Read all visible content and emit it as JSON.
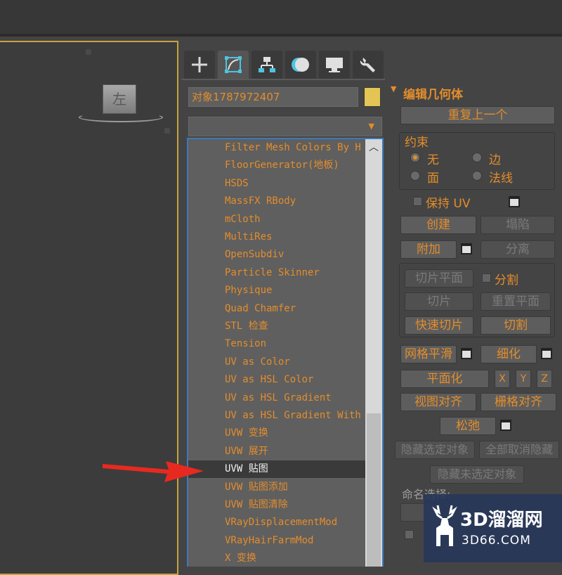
{
  "viewport": {
    "viewcube_label": "左"
  },
  "command_panel": {
    "tabs": [
      {
        "icon": "plus-icon"
      },
      {
        "icon": "modify-icon"
      },
      {
        "icon": "hierarchy-icon"
      },
      {
        "icon": "motion-icon"
      },
      {
        "icon": "display-icon"
      },
      {
        "icon": "wrench-icon"
      }
    ],
    "object_name": "对象1787972407",
    "object_color": "#e4c454",
    "modifier_dropdown": {
      "value": "",
      "arrow": "▼"
    },
    "modifier_list": {
      "items": [
        "Filter Mesh Colors By H",
        "FloorGenerator(地板)",
        "HSDS",
        "MassFX RBody",
        "mCloth",
        "MultiRes",
        "OpenSubdiv",
        "Particle Skinner",
        "Physique",
        "Quad Chamfer",
        "STL 检查",
        "Tension",
        "UV as Color",
        "UV as HSL Color",
        "UV as HSL Gradient",
        "UV as HSL Gradient With",
        "UVW 变换",
        "UVW 展开",
        "UVW 贴图",
        "UVW 贴图添加",
        "UVW 贴图清除",
        "VRayDisplacementMod",
        "VRayHairFarmMod",
        "X 变换"
      ],
      "selected_index": 18
    }
  },
  "rollout": {
    "title": "编辑几何体",
    "repeat_last": "重复上一个",
    "constraints": {
      "label": "约束",
      "none": "无",
      "edge": "边",
      "face": "面",
      "normal": "法线"
    },
    "preserve_uv": "保持 UV",
    "create": "创建",
    "collapse": "塌陷",
    "attach": "附加",
    "detach": "分离",
    "slice_plane": "切片平面",
    "split": "分割",
    "slice": "切片",
    "reset_plane": "重置平面",
    "quickslice": "快速切片",
    "cut": "切割",
    "meshsmooth": "网格平滑",
    "tessellate": "细化",
    "make_planar": "平面化",
    "x": "X",
    "y": "Y",
    "z": "Z",
    "view_align": "视图对齐",
    "grid_align": "栅格对齐",
    "relax": "松弛",
    "hide_selected": "隐藏选定对象",
    "unhide_all": "全部取消隐藏",
    "hide_unselected": "隐藏未选定对象",
    "named_selections": "命名选择:"
  },
  "watermark": {
    "brand": "3D溜溜网",
    "url": "3D66.COM"
  }
}
